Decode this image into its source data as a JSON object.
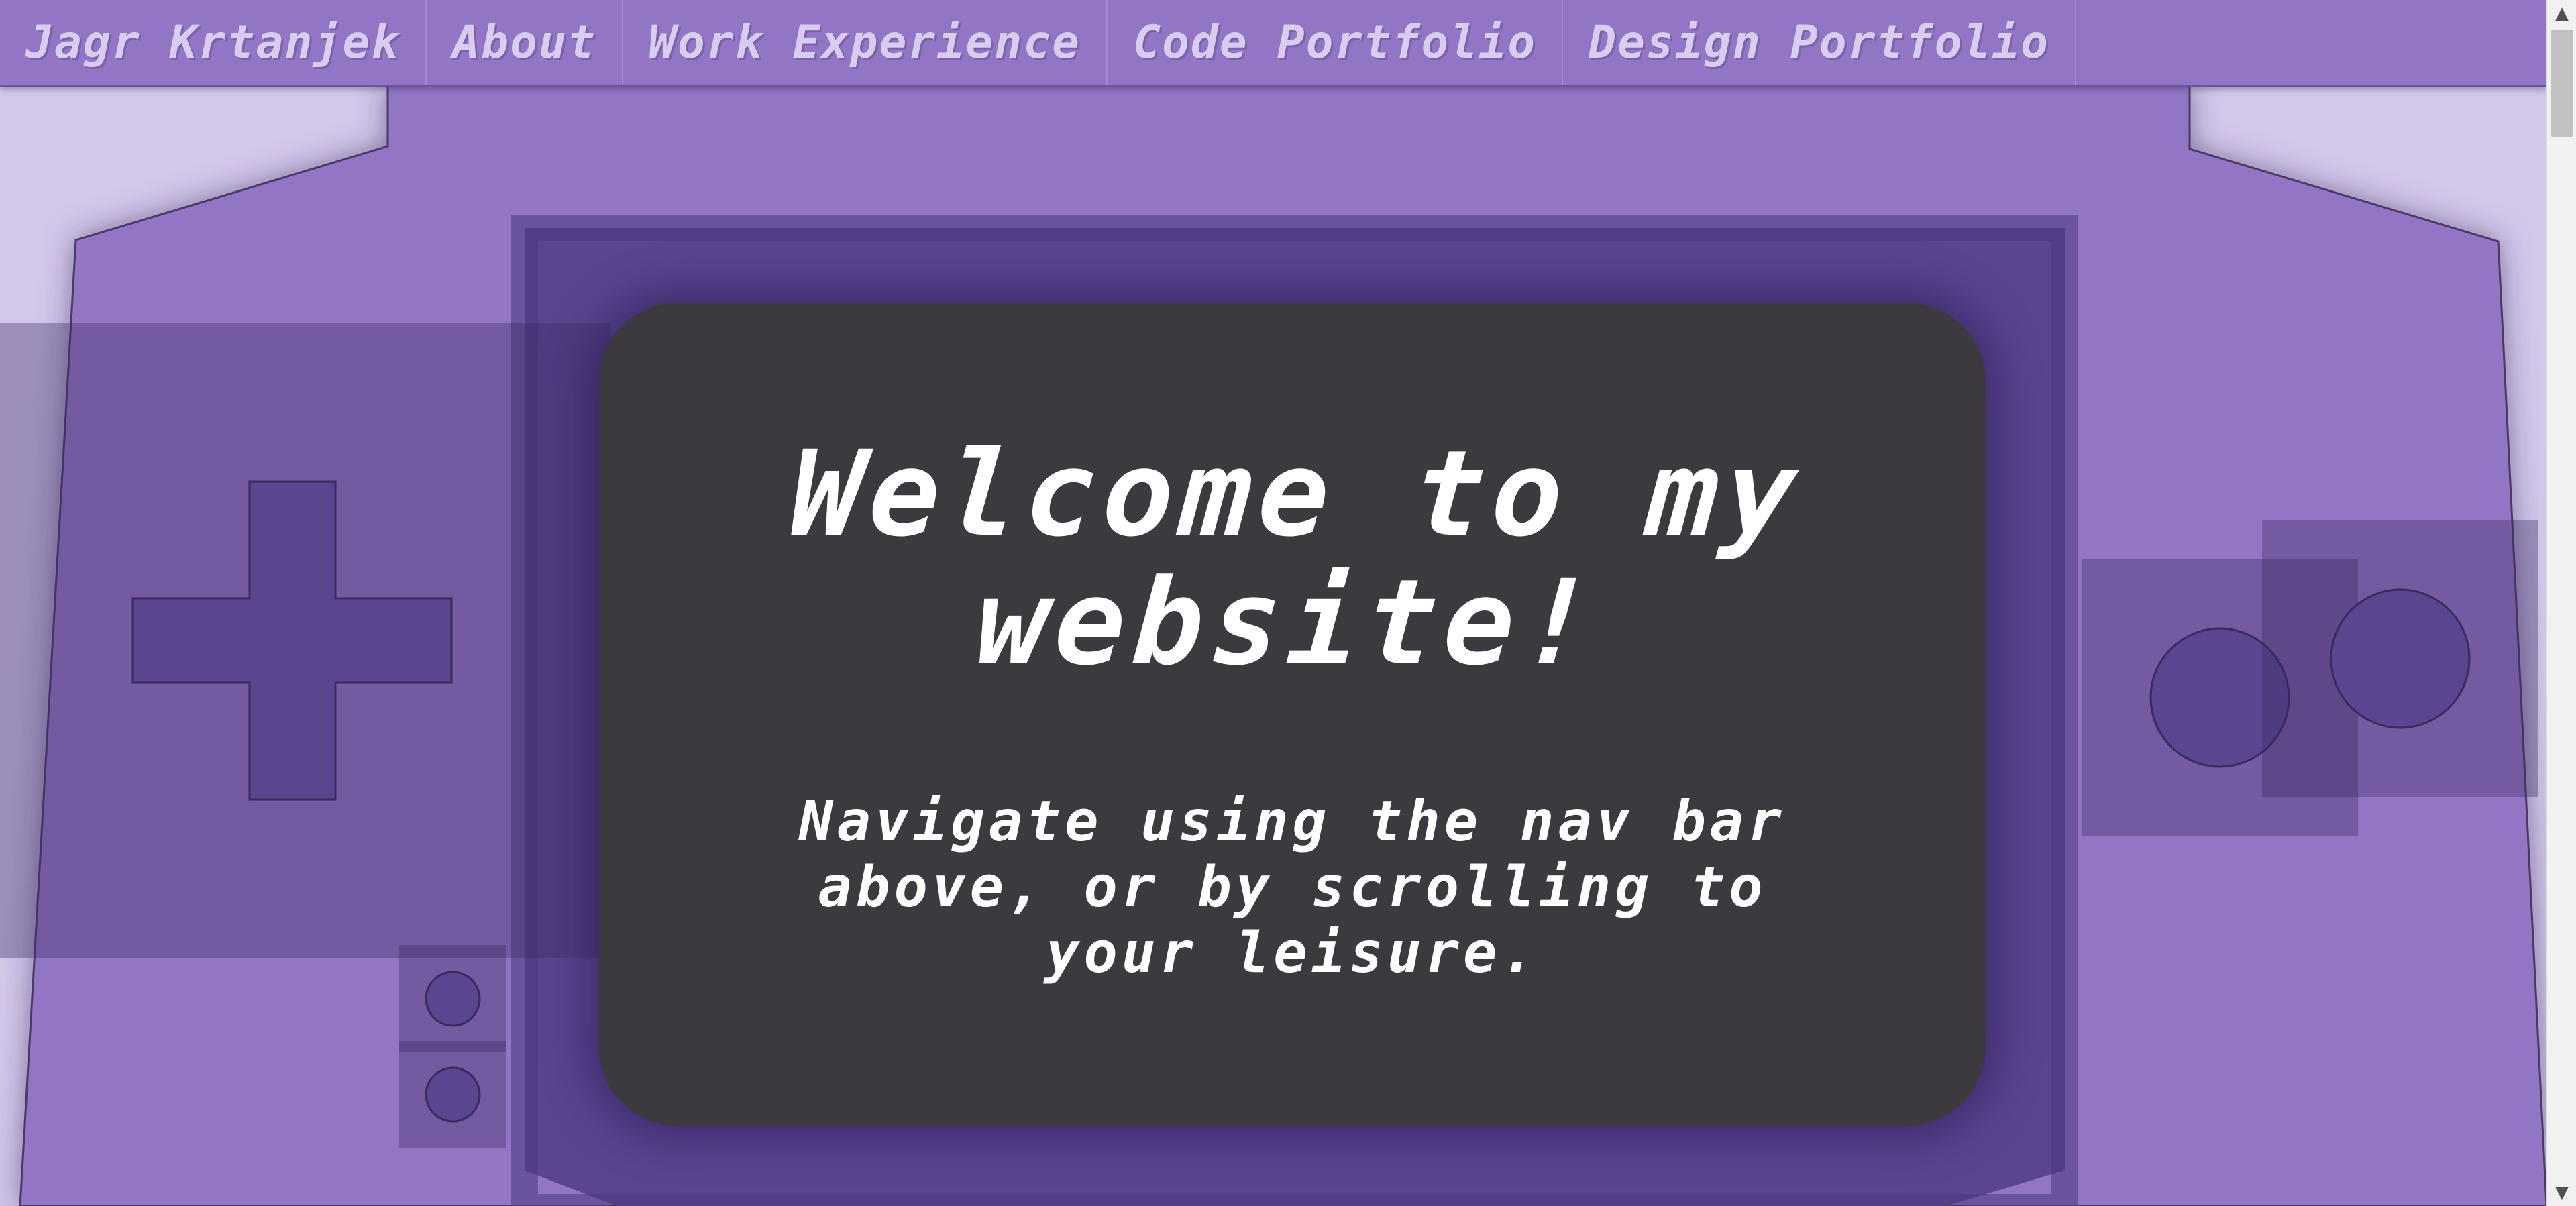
{
  "nav": {
    "items": [
      {
        "label": "Jagr Krtanjek"
      },
      {
        "label": "About"
      },
      {
        "label": "Work Experience"
      },
      {
        "label": "Code Portfolio"
      },
      {
        "label": "Design Portfolio"
      }
    ]
  },
  "screen": {
    "title": "Welcome to my website!",
    "subtitle": "Navigate using the nav bar above, or by scrolling to your leisure."
  },
  "scrollbar": {
    "up_arrow": "▲",
    "down_arrow": "▼"
  },
  "colors": {
    "background": "#d3c8ea",
    "console_body": "#9276c5",
    "console_dark": "#5a4590",
    "screen": "#3c393f",
    "nav_text": "#d9cdef"
  }
}
